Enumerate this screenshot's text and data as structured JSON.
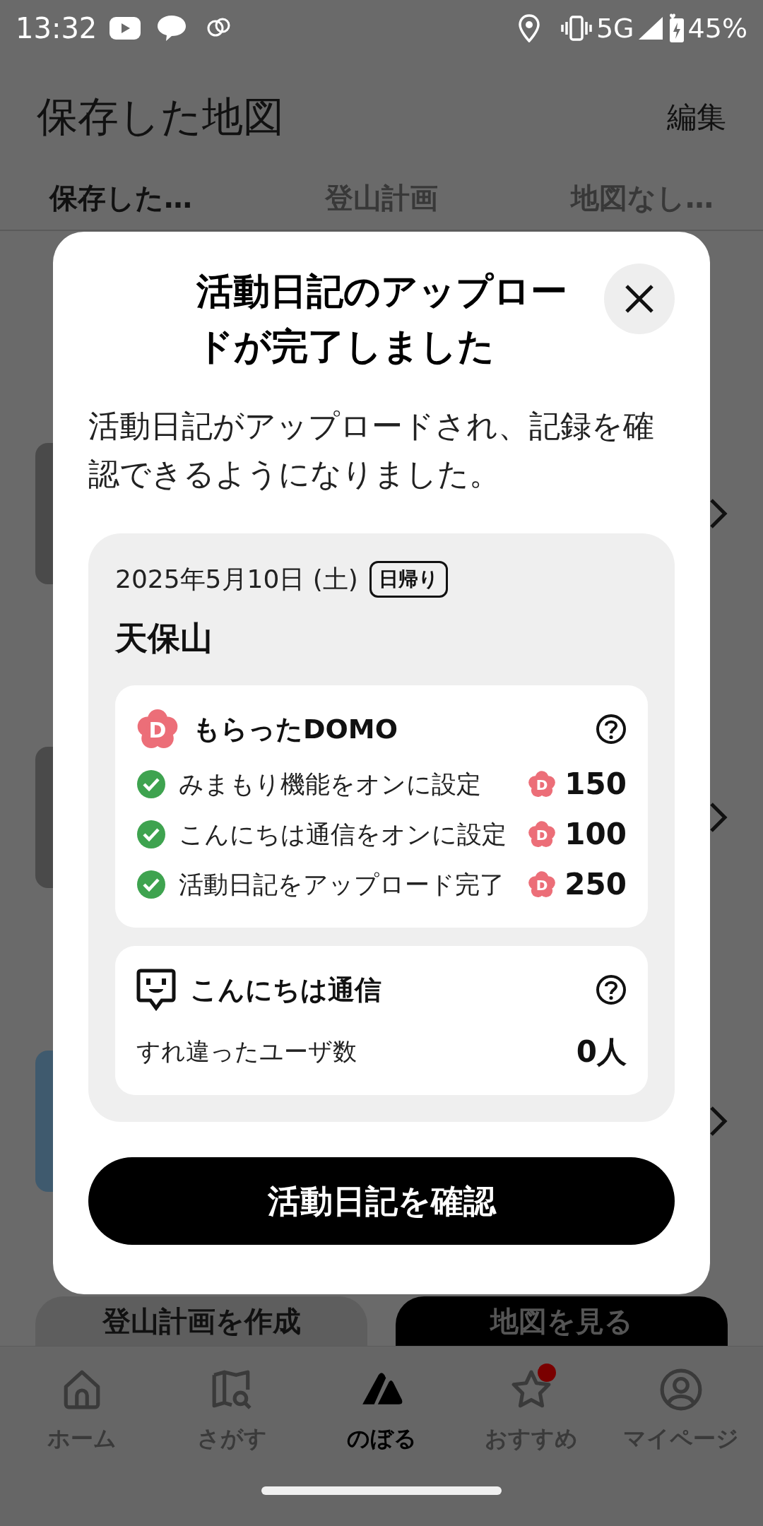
{
  "status_bar": {
    "time": "13:32",
    "network": "5G",
    "battery": "45%"
  },
  "header": {
    "title": "保存した地図",
    "edit": "編集"
  },
  "tabs": [
    {
      "label": "保存した…",
      "selected": true
    },
    {
      "label": "登山計画",
      "selected": false
    },
    {
      "label": "地図なし…",
      "selected": false
    }
  ],
  "bottom_buttons": [
    {
      "label": "登山計画を作成",
      "kind": "secondary"
    },
    {
      "label": "地図を見る",
      "kind": "primary"
    }
  ],
  "dialog": {
    "title": "活動日記のアップロードが完了しました",
    "message": "活動日記がアップロードされ、記録を確認できるようになりました。",
    "activity": {
      "date": "2025年5月10日 (土)",
      "tag": "日帰り",
      "mountain": "天保山"
    },
    "domo": {
      "icon_letter": "D",
      "title": "もらったDOMO",
      "items": [
        {
          "label": "みまもり機能をオンに設定",
          "checked": true,
          "icon_letter": "D",
          "points": "150"
        },
        {
          "label": "こんにちは通信をオンに設定",
          "checked": true,
          "icon_letter": "D",
          "points": "100"
        },
        {
          "label": "活動日記をアップロード完了",
          "checked": true,
          "icon_letter": "D",
          "points": "250"
        }
      ]
    },
    "konnichiwa": {
      "title": "こんにちは通信",
      "label": "すれ違ったユーザ数",
      "value": "0人"
    },
    "button": "活動日記を確認"
  },
  "nav": [
    {
      "label": "ホーム",
      "kind": "home",
      "selected": false,
      "badge": false
    },
    {
      "label": "さがす",
      "kind": "search",
      "selected": false,
      "badge": false
    },
    {
      "label": "のぼる",
      "kind": "climb",
      "selected": true,
      "badge": false
    },
    {
      "label": "おすすめ",
      "kind": "recommend",
      "selected": false,
      "badge": true
    },
    {
      "label": "マイページ",
      "kind": "mypage",
      "selected": false,
      "badge": false
    }
  ]
}
